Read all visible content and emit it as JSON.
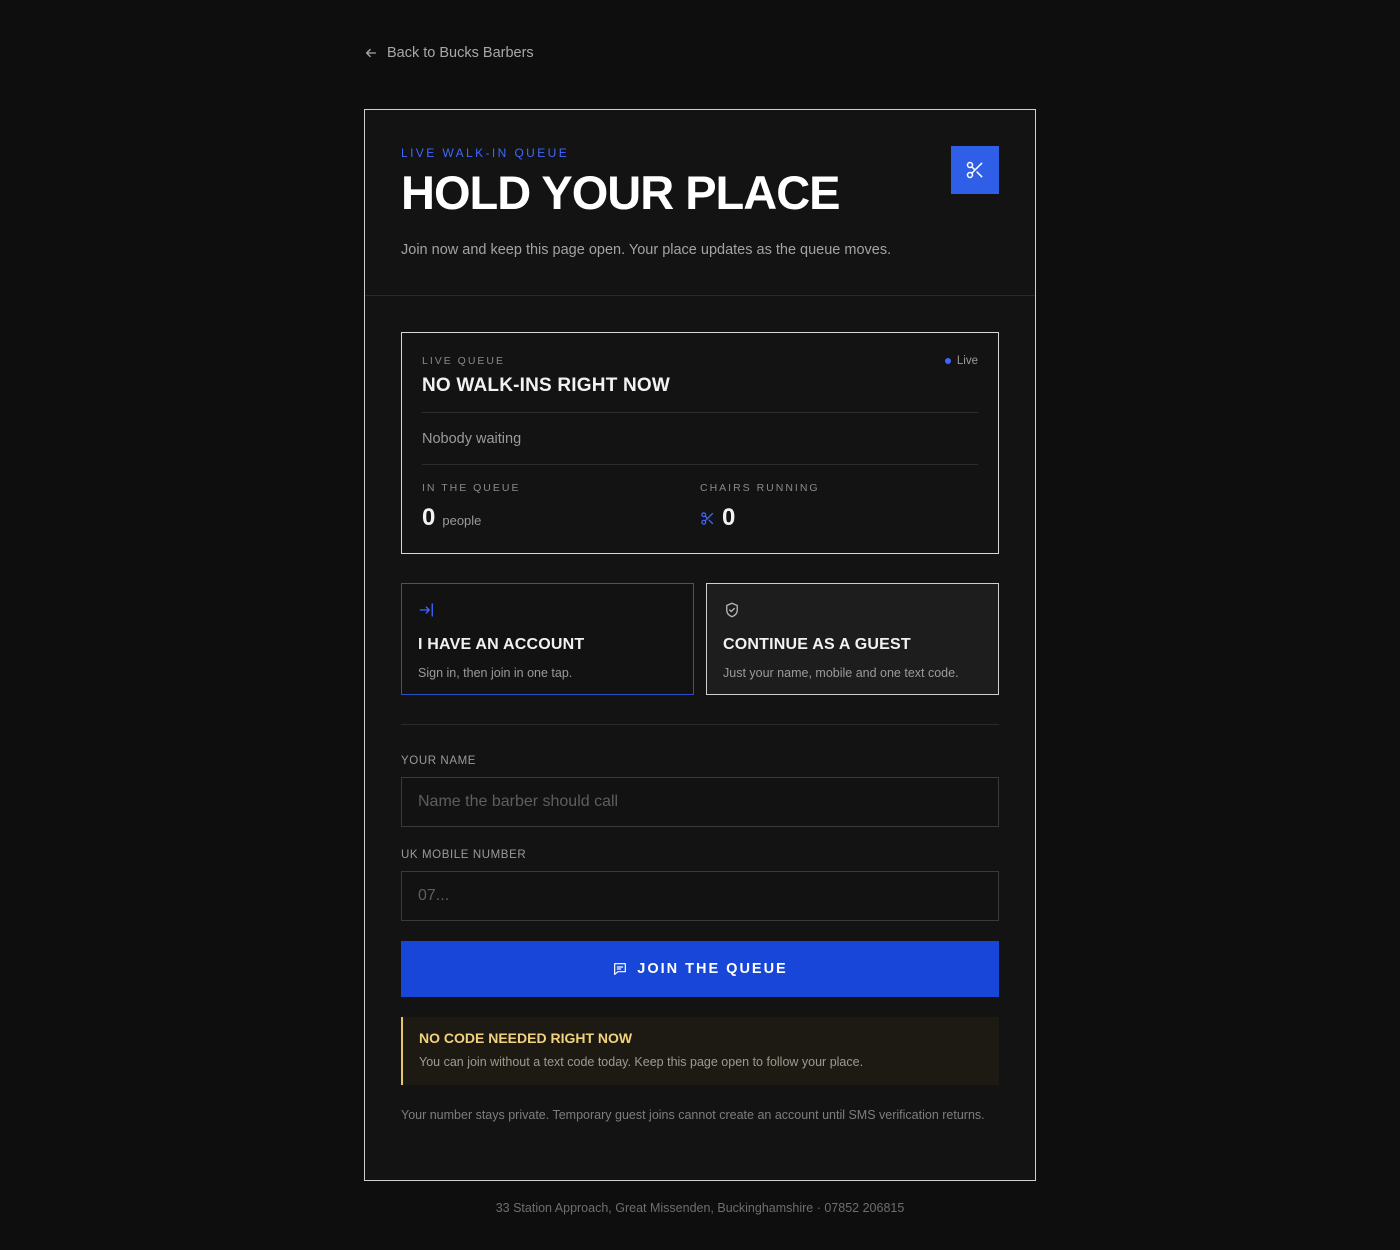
{
  "nav": {
    "back_label": "Back to Bucks Barbers"
  },
  "header": {
    "eyebrow": "LIVE WALK-IN QUEUE",
    "title": "HOLD YOUR PLACE",
    "subtitle": "Join now and keep this page open. Your place updates as the queue moves.",
    "icon": "scissors-icon"
  },
  "queue": {
    "label": "LIVE QUEUE",
    "status": "Live",
    "title": "NO WALK-INS RIGHT NOW",
    "waiting_text": "Nobody waiting",
    "in_queue_label": "IN THE QUEUE",
    "in_queue_value": "0",
    "in_queue_unit": "people",
    "chairs_label": "CHAIRS RUNNING",
    "chairs_value": "0"
  },
  "options": {
    "account": {
      "title": "I HAVE AN ACCOUNT",
      "desc": "Sign in, then join in one tap.",
      "icon": "sign-in-icon"
    },
    "guest": {
      "title": "CONTINUE AS A GUEST",
      "desc": "Just your name, mobile and one text code.",
      "icon": "shield-check-icon"
    }
  },
  "form": {
    "name_label": "YOUR NAME",
    "name_placeholder": "Name the barber should call",
    "mobile_label": "UK MOBILE NUMBER",
    "mobile_placeholder": "07...",
    "submit_label": "JOIN THE QUEUE"
  },
  "notice": {
    "title": "NO CODE NEEDED RIGHT NOW",
    "text": "You can join without a text code today. Keep this page open to follow your place."
  },
  "privacy": "Your number stays private. Temporary guest joins cannot create an account until SMS verification returns.",
  "footer": "33 Station Approach, Great Missenden, Buckinghamshire · 07852 206815",
  "colors": {
    "accent": "#1746d8",
    "accent_light": "#3f67ff",
    "notice": "#e7c667",
    "background": "#0e0e0e"
  }
}
